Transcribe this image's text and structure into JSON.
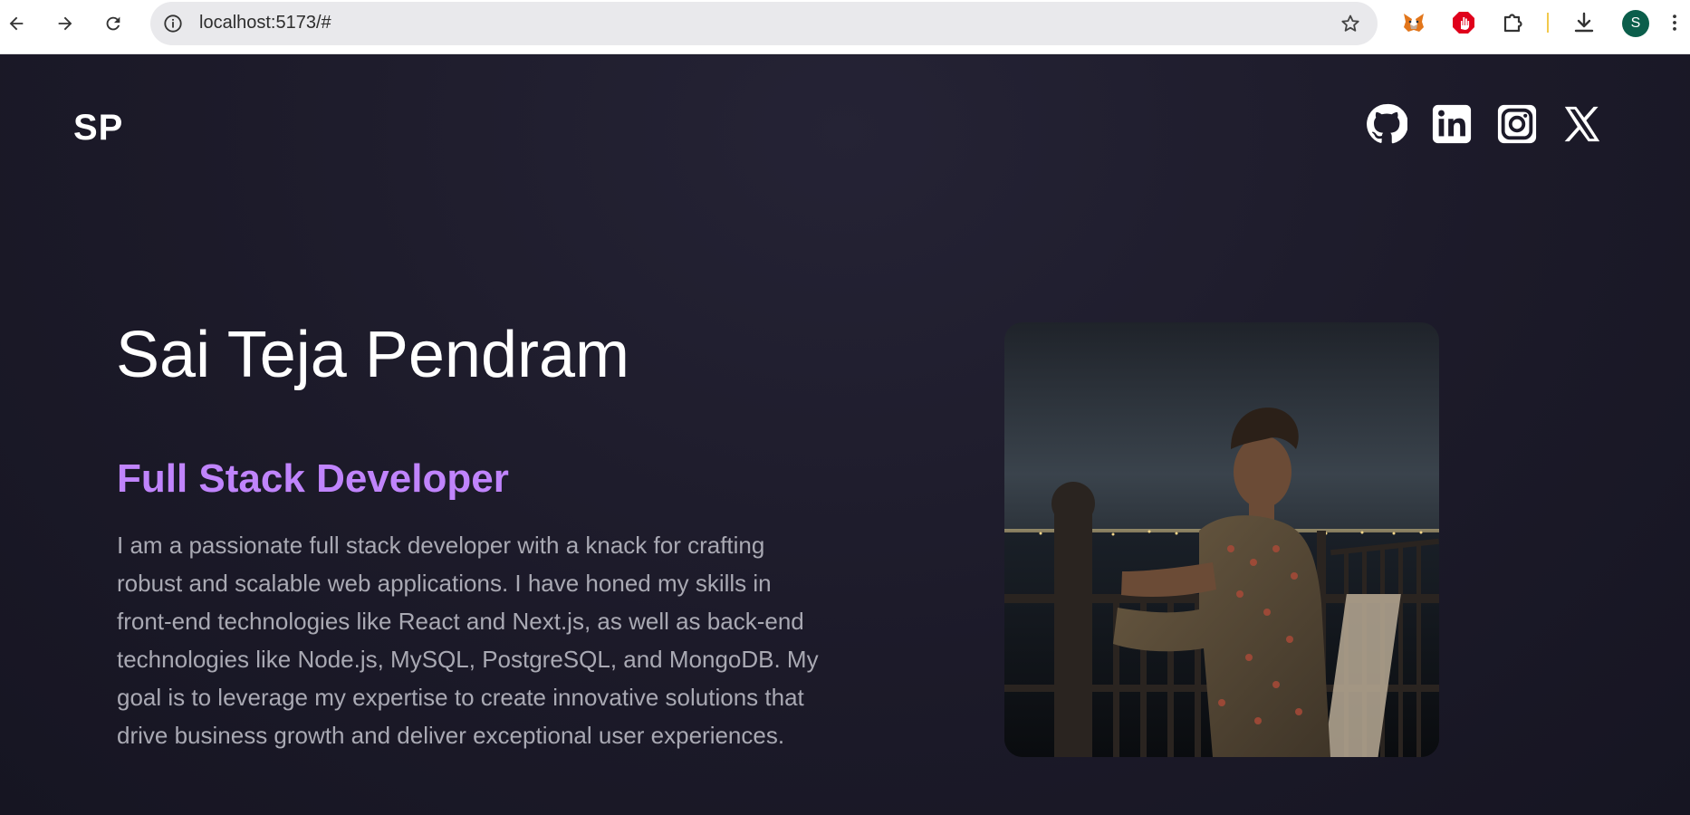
{
  "browser": {
    "url": "localhost:5173/#",
    "profile_initial": "S",
    "icons": [
      "back-arrow-icon",
      "forward-arrow-icon",
      "reload-icon",
      "info-icon",
      "star-icon",
      "metamask-icon",
      "adblock-icon",
      "puzzle-icon",
      "download-icon"
    ]
  },
  "site": {
    "logo": "SP",
    "social": [
      "github-icon",
      "linkedin-icon",
      "instagram-icon",
      "x-icon"
    ]
  },
  "hero": {
    "name": "Sai Teja Pendram",
    "role": "Full Stack Developer",
    "bio": "I am a passionate full stack developer with a knack for crafting robust and scalable web applications. I have honed my skills in front-end technologies like React and Next.js, as well as back-end technologies like Node.js, MySQL, PostgreSQL, and MongoDB. My goal is to leverage my expertise to create innovative solutions that drive business growth and deliver exceptional user experiences."
  },
  "colors": {
    "background": "#1d1b2b",
    "accent": "#c084fc",
    "text": "#ffffff",
    "muted": "#a9a9b3"
  }
}
